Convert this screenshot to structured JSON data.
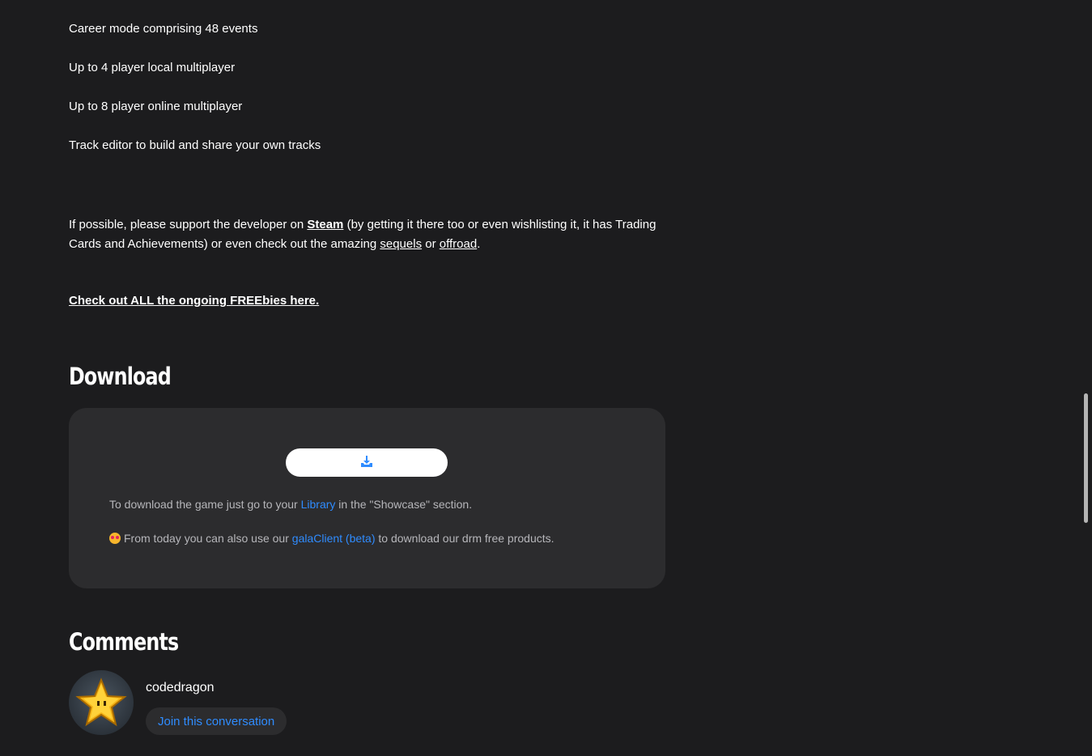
{
  "features": [
    "Career mode comprising 48 events",
    "Up to 4 player local multiplayer",
    "Up to 8 player online multiplayer",
    "Track editor to build and share your own tracks"
  ],
  "support": {
    "part1": "If possible, please support the developer on ",
    "steam_link": "Steam",
    "part2": " (by getting it there too or even wishlisting it, it has Trading Cards and Achievements) or even check out the amazing ",
    "sequels_link": "sequels",
    "part3": " or ",
    "offroad_link": "offroad",
    "part4": "."
  },
  "freebies_link": "Check out ALL the ongoing FREEbies here.",
  "download": {
    "title": "Download",
    "button_icon": "download-icon",
    "note1_before": "To download the game just go to your ",
    "note1_link": "Library",
    "note1_after": " in the \"Showcase\" section.",
    "note2_icon": "star-struck-emoji",
    "note2_before": "From today you can also use our ",
    "note2_link": "galaClient (beta)",
    "note2_after": " to download our drm free products."
  },
  "comments": {
    "title": "Comments",
    "username": "codedragon",
    "join_label": "Join this conversation"
  },
  "colors": {
    "background": "#1c1c1e",
    "card": "#2c2c2e",
    "accent_link": "#2f8cff",
    "muted_text": "#b6b6ba"
  }
}
